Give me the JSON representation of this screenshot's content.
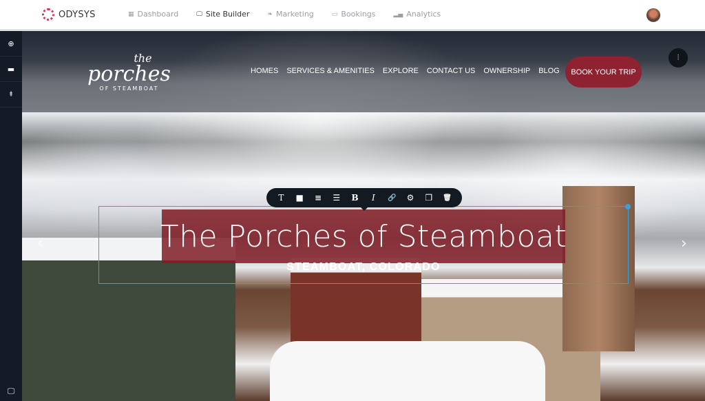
{
  "app": {
    "name": "ODYSYS",
    "brand_color": "#d23a5a"
  },
  "topnav": [
    {
      "label": "Dashboard",
      "icon": "grid-icon",
      "active": false
    },
    {
      "label": "Site Builder",
      "icon": "monitor-icon",
      "active": true
    },
    {
      "label": "Marketing",
      "icon": "leaf-icon",
      "active": false
    },
    {
      "label": "Bookings",
      "icon": "calendar-icon",
      "active": false
    },
    {
      "label": "Analytics",
      "icon": "bar-chart-icon",
      "active": false
    }
  ],
  "sidebar": {
    "items": [
      {
        "icon": "add-circle-icon"
      },
      {
        "icon": "layers-icon"
      },
      {
        "icon": "components-icon"
      }
    ],
    "bottom": {
      "icon": "monitor-icon"
    }
  },
  "site": {
    "logo": {
      "line1": "the",
      "line2": "porches",
      "line3": "OF STEAMBOAT"
    },
    "nav": [
      "HOMES",
      "SERVICES & AMENITIES",
      "EXPLORE",
      "CONTACT US",
      "OWNERSHIP",
      "BLOG"
    ],
    "cta": "BOOK YOUR TRIP",
    "cta_color": "#8e2230",
    "hero": {
      "title": "The Porches of Steamboat",
      "subtitle": "STEAMBOAT, COLORADO"
    }
  },
  "toolbar": [
    {
      "icon": "text-type-icon",
      "glyph": "T"
    },
    {
      "icon": "background-color-icon",
      "glyph": "■"
    },
    {
      "icon": "align-center-icon",
      "glyph": "≡"
    },
    {
      "icon": "align-left-icon",
      "glyph": "☰"
    },
    {
      "icon": "bold-icon",
      "glyph": "B"
    },
    {
      "icon": "italic-icon",
      "glyph": "I"
    },
    {
      "icon": "link-icon",
      "glyph": "🔗"
    },
    {
      "icon": "settings-icon",
      "glyph": "⚙"
    },
    {
      "icon": "duplicate-icon",
      "glyph": "❐"
    },
    {
      "icon": "delete-icon",
      "glyph": "🗑"
    }
  ],
  "selection_color": "#3aa0d8"
}
